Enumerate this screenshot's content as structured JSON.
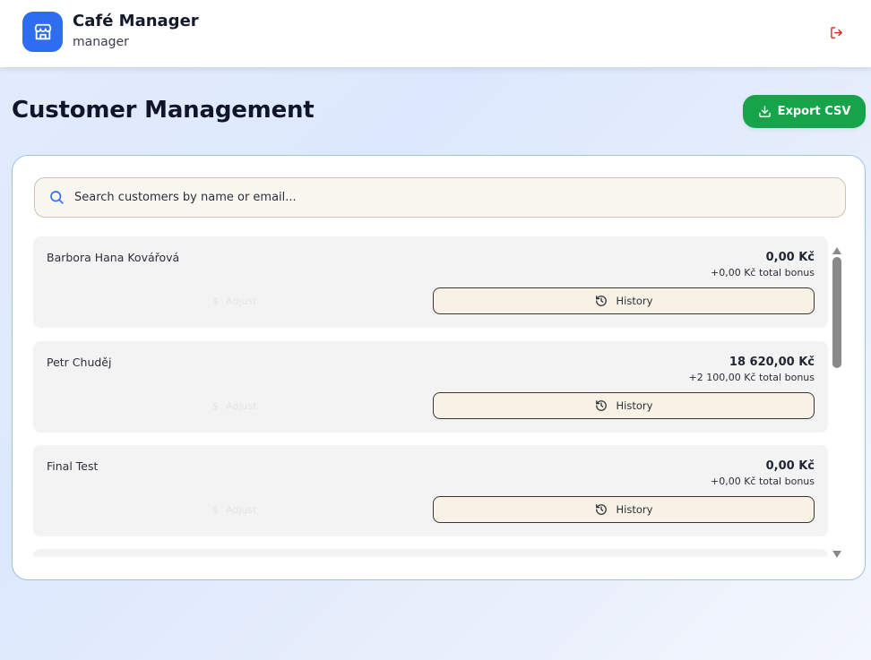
{
  "header": {
    "app_title": "Café Manager",
    "role": "manager",
    "logo_icon": "store-icon",
    "logout_icon": "logout-icon"
  },
  "page": {
    "title": "Customer Management",
    "export_label": "Export CSV"
  },
  "search": {
    "placeholder": "Search customers by name or email...",
    "value": ""
  },
  "customers": [
    {
      "name": "Barbora Hana Kovářová",
      "balance": "0,00 Kč",
      "bonus": "+0,00 Kč total bonus",
      "adjust_label": "Adjust",
      "history_label": "History"
    },
    {
      "name": "Petr Chuděj",
      "balance": "18 620,00 Kč",
      "bonus": "+2 100,00 Kč total bonus",
      "adjust_label": "Adjust",
      "history_label": "History"
    },
    {
      "name": "Final Test",
      "balance": "0,00 Kč",
      "bonus": "+0,00 Kč total bonus",
      "adjust_label": "Adjust",
      "history_label": "History"
    }
  ],
  "colors": {
    "brand": "#2f6df0",
    "export": "#16a34a",
    "logout": "#dc2626",
    "history_bg": "#f7f1e6"
  }
}
